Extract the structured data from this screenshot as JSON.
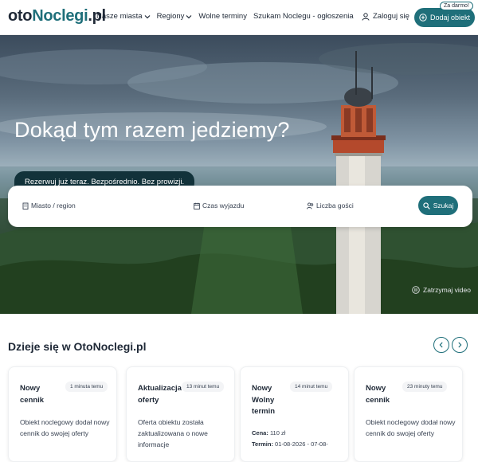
{
  "header": {
    "logo_part1": "oto",
    "logo_part2": "Noclegi",
    "logo_part3": ".pl",
    "nav": [
      {
        "label": "Nasze miasta",
        "has_dropdown": true
      },
      {
        "label": "Regiony",
        "has_dropdown": true
      },
      {
        "label": "Wolne terminy",
        "has_dropdown": false
      },
      {
        "label": "Szukam Noclegu - ogłoszenia",
        "has_dropdown": false
      }
    ],
    "login_label": "Zaloguj się",
    "add_label": "Dodaj obiekt",
    "free_badge": "Za darmo!"
  },
  "hero": {
    "title": "Dokąd tym razem jedziemy?",
    "tagline": "Rezerwuj już teraz. Bezpośrednio. Bez prowizji.",
    "search": {
      "city_label": "Miasto / region",
      "dates_label": "Czas wyjazdu",
      "guests_label": "Liczba gości",
      "button_label": "Szukaj"
    },
    "stop_video_label": "Zatrzymaj video"
  },
  "news": {
    "title": "Dzieje się w OtoNoclegi.pl",
    "cards": [
      {
        "title": "Nowy cennik",
        "time": "1 minuta temu",
        "desc": "Obiekt noclegowy dodał nowy cennik do swojej oferty"
      },
      {
        "title": "Aktualizacja oferty",
        "time": "13 minut temu",
        "desc": "Oferta obiektu została zaktualizowana o nowe informacje"
      },
      {
        "title": "Nowy Wolny termin",
        "time": "14 minut temu",
        "price_label": "Cena:",
        "price_value": "110 zł",
        "term_label": "Termin:",
        "term_value": "01-08-2026 - 07-08-"
      },
      {
        "title": "Nowy cennik",
        "time": "23 minuty temu",
        "desc": "Obiekt noclegowy dodał nowy cennik do swojej oferty"
      }
    ]
  },
  "colors": {
    "accent": "#1f6f7a",
    "tagline_bg": "#12323a"
  }
}
